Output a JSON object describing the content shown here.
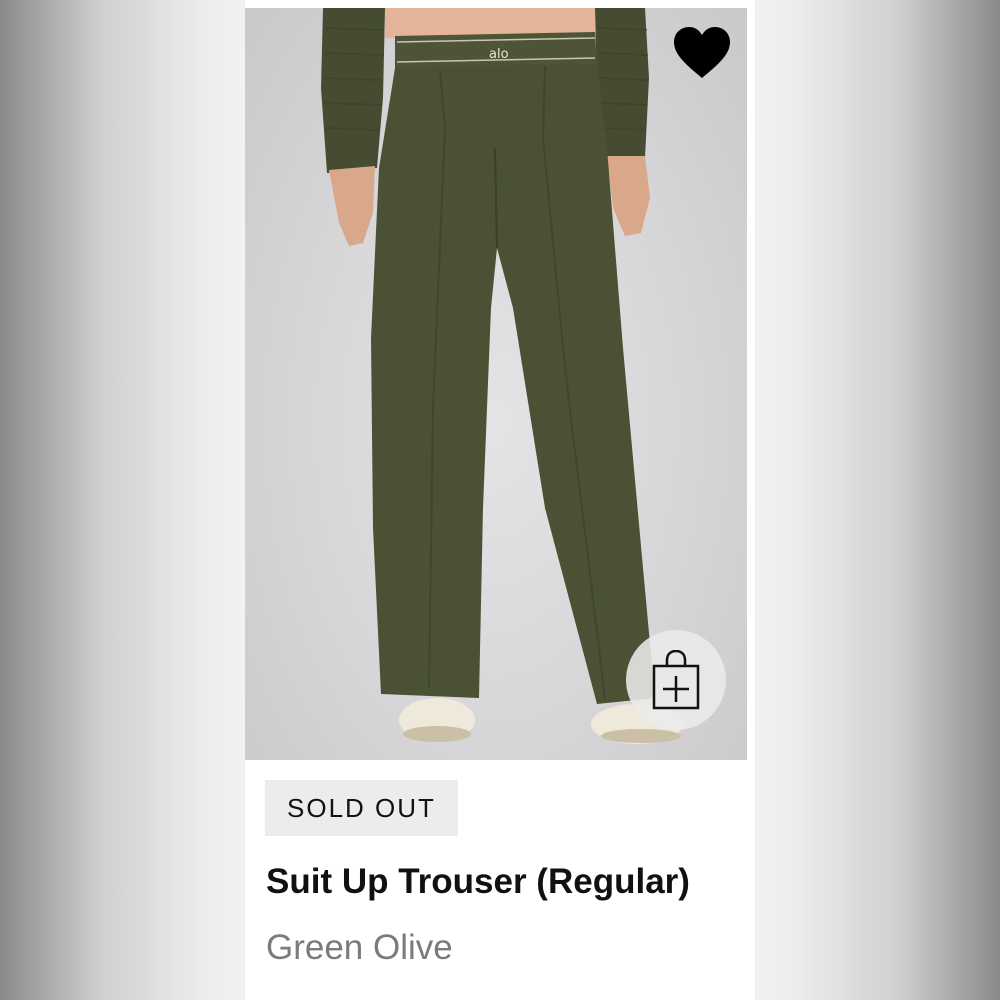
{
  "product": {
    "image_alt": "Suit Up Trouser (Regular) in Green Olive",
    "brand_mark": "alo",
    "badge": "SOLD OUT",
    "name": "Suit Up Trouser (Regular)",
    "color": "Green Olive",
    "wishlisted": true
  },
  "actions": {
    "wishlist_icon": "heart-icon",
    "add_to_bag_icon": "shopping-bag-plus-icon"
  },
  "colors": {
    "fabric": "#4a5134",
    "badge_bg": "#ececec",
    "title": "#111111",
    "subtitle": "#7b7b7b"
  }
}
